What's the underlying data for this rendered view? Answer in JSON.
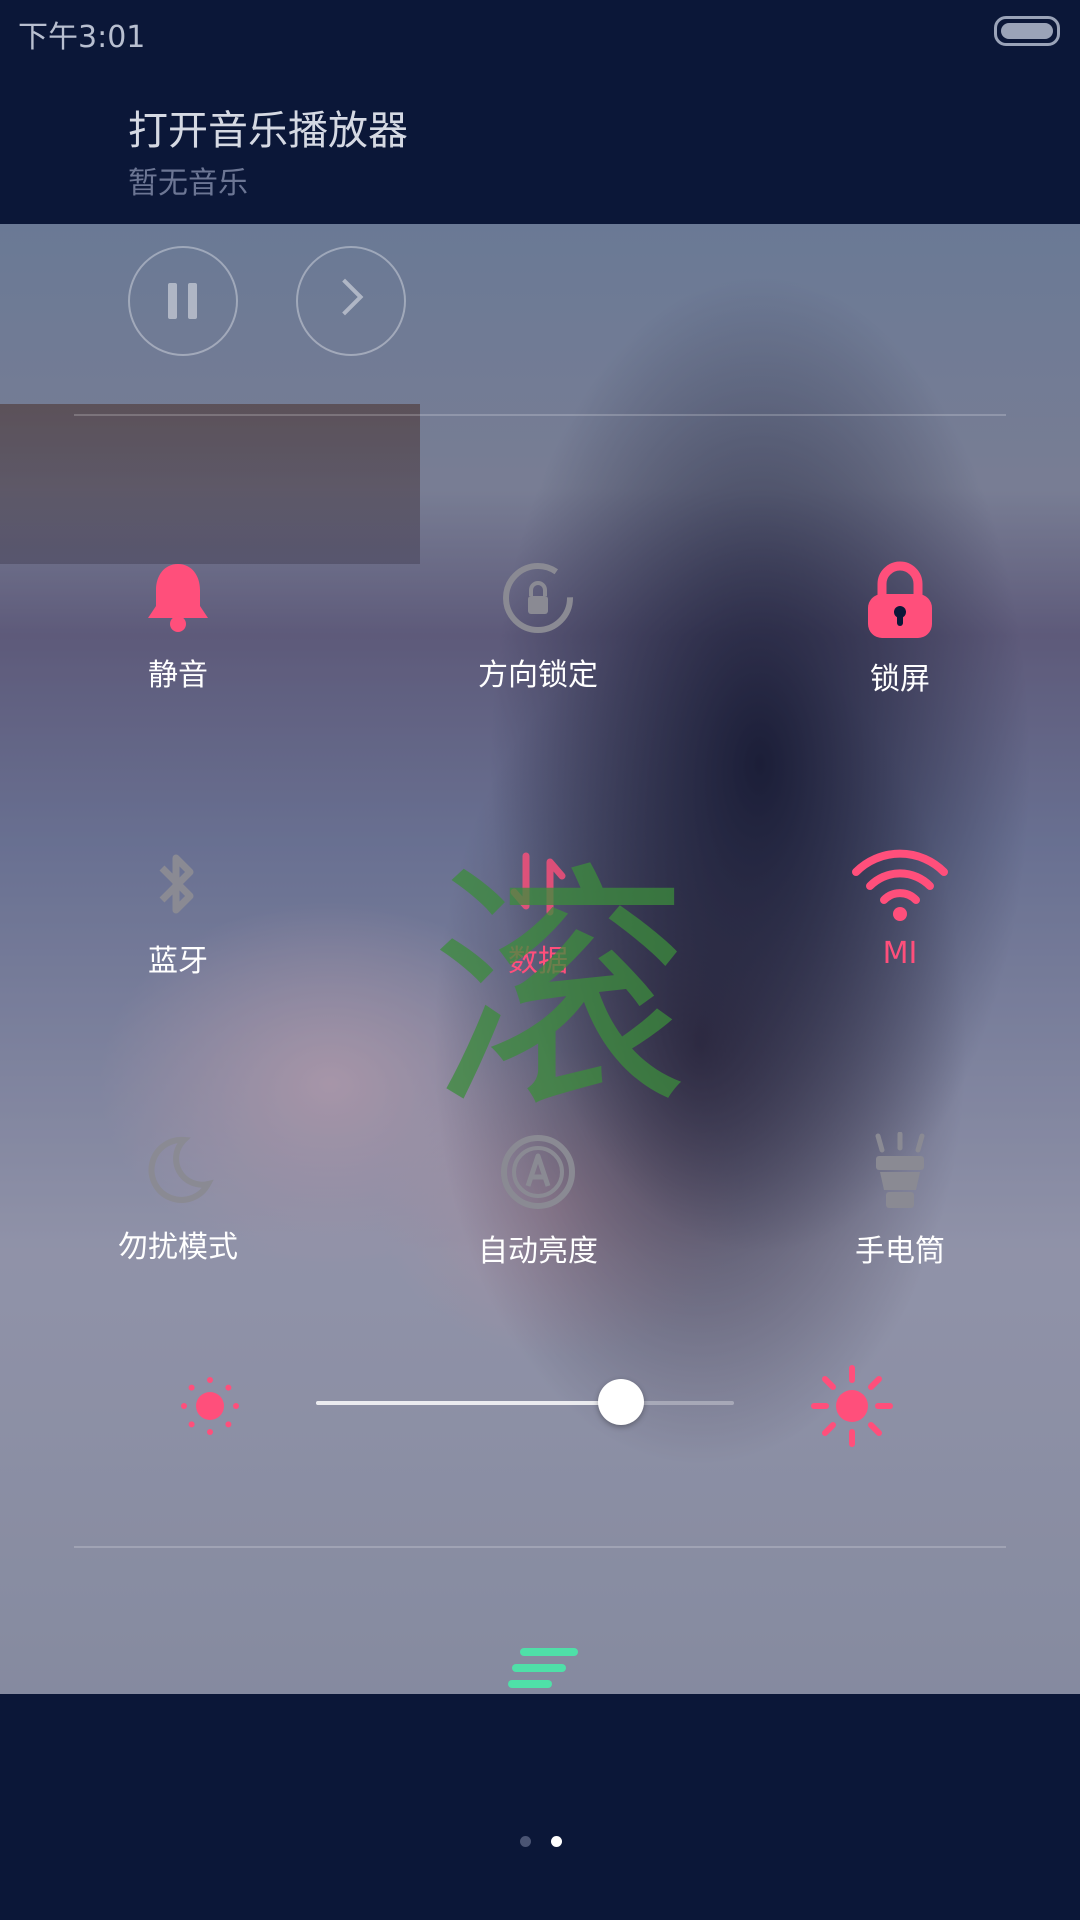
{
  "status_bar": {
    "time": "下午3:01"
  },
  "music": {
    "title": "打开音乐播放器",
    "subtitle": "暂无音乐"
  },
  "toggles": {
    "row1": [
      {
        "label": "静音",
        "icon": "bell-icon",
        "active": true
      },
      {
        "label": "方向锁定",
        "icon": "rotation-lock-icon",
        "active": false
      },
      {
        "label": "锁屏",
        "icon": "lock-icon",
        "active": true
      }
    ],
    "row2": [
      {
        "label": "蓝牙",
        "icon": "bluetooth-icon",
        "active": false
      },
      {
        "label": "数据",
        "icon": "mobile-data-icon",
        "active": true
      },
      {
        "label": "MI",
        "icon": "wifi-icon",
        "active": true
      }
    ],
    "row3": [
      {
        "label": "勿扰模式",
        "icon": "moon-icon",
        "active": false
      },
      {
        "label": "自动亮度",
        "icon": "auto-brightness-icon",
        "active": false
      },
      {
        "label": "手电筒",
        "icon": "flashlight-icon",
        "active": false
      }
    ]
  },
  "brightness": {
    "level": 0.73
  },
  "overlay_text": "滚",
  "pager": {
    "count": 2,
    "current": 2
  },
  "colors": {
    "accent": "#ff4f7b",
    "handle": "#4fe0a8",
    "background": "#0b1738",
    "inactive_icon": "#8a8a93",
    "watermark": "#3c8c3c"
  }
}
